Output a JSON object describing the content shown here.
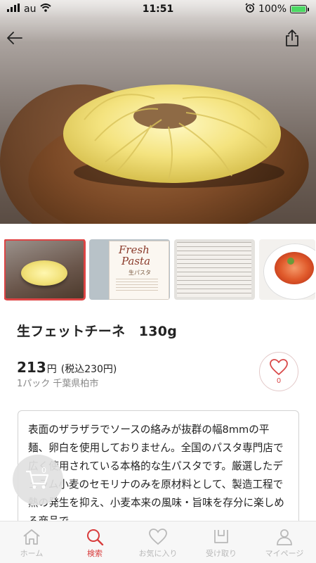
{
  "status_bar": {
    "carrier": "au",
    "time": "11:51",
    "battery": "100%"
  },
  "product": {
    "title": "生フェットチーネ　130g",
    "price": "213",
    "price_unit": "円",
    "tax_included": "(税込230円)",
    "meta": "1パック 千葉県柏市",
    "favorite_count": "0"
  },
  "thumbnail_texts": {
    "brand_line1": "Fresh",
    "brand_line2": "Pasta",
    "brand_sub": "生パスタ"
  },
  "description": "表面のザラザラでソースの絡みが抜群の幅8mmの平麺、卵白を使用しておりません。全国のパスタ専門店で広く使用されている本格的な生パスタです。厳選したデュラム小麦のセモリナのみを原材料として、製造工程で熱の発生を抑え、小麦本来の風味・旨味を存分に楽しめる商品で",
  "cart": {
    "count": "0"
  },
  "nav": [
    {
      "label": "ホーム",
      "icon": "home-icon"
    },
    {
      "label": "検索",
      "icon": "search-icon"
    },
    {
      "label": "お気に入り",
      "icon": "heart-icon"
    },
    {
      "label": "受け取り",
      "icon": "pickup-icon"
    },
    {
      "label": "マイページ",
      "icon": "person-icon"
    }
  ],
  "colors": {
    "accent": "#d83c3c",
    "inactive": "#b9b9b9",
    "price_meta": "#888888"
  }
}
